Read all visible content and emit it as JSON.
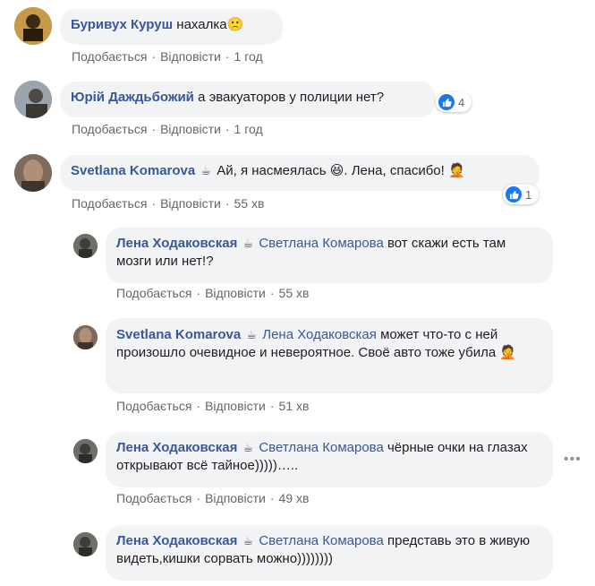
{
  "comments": [
    {
      "author": "Буривух Куруш",
      "text": "нахалка",
      "emoji": "🙁",
      "actions": {
        "like": "Подобається",
        "reply": "Відповісти",
        "time": "1 год"
      }
    },
    {
      "author": "Юрій Даждьбожий",
      "text": "а эвакуаторов у полиции нет?",
      "reaction_count": "4",
      "actions": {
        "like": "Подобається",
        "reply": "Відповісти",
        "time": "1 год"
      }
    },
    {
      "author": "Svetlana Komarova",
      "cup": "☕",
      "text_a": "Ай, я насмеялась",
      "emoji_a": "😆",
      "text_b": ". Лена, спасибо!",
      "emoji_b": "🤦",
      "reaction_count": "1",
      "actions": {
        "like": "Подобається",
        "reply": "Відповісти",
        "time": "55 хв"
      }
    }
  ],
  "replies": [
    {
      "author": "Лена Ходаковская",
      "cup": "☕",
      "mention": "Светлана Комарова",
      "text": "вот скажи есть там мозги или нет!?",
      "actions": {
        "like": "Подобається",
        "reply": "Відповісти",
        "time": "55 хв"
      }
    },
    {
      "author": "Svetlana Komarova",
      "cup": "☕",
      "mention": "Лена Ходаковская",
      "text": "может что-то с ней произошло очевидное и невероятное. Своё авто тоже убила",
      "emoji": "🤦",
      "actions": {
        "like": "Подобається",
        "reply": "Відповісти",
        "time": "51 хв"
      }
    },
    {
      "author": "Лена Ходаковская",
      "cup": "☕",
      "mention": "Светлана Комарова",
      "text": "чёрные очки на глазах открывают всё тайное)))))…..",
      "more": "•••",
      "actions": {
        "like": "Подобається",
        "reply": "Відповісти",
        "time": "49 хв"
      }
    },
    {
      "author": "Лена Ходаковская",
      "cup": "☕",
      "mention": "Светлана Комарова",
      "text": "представь это в живую видеть,кишки сорвать можно))))))))"
    }
  ],
  "colors": {
    "author": "#385898",
    "bubble": "#f2f3f5",
    "meta": "#606770",
    "like": "#1877f2"
  },
  "icons": {
    "coffee": "coffee-cup-icon",
    "like": "thumbs-up-icon",
    "more": "more-options-icon"
  }
}
